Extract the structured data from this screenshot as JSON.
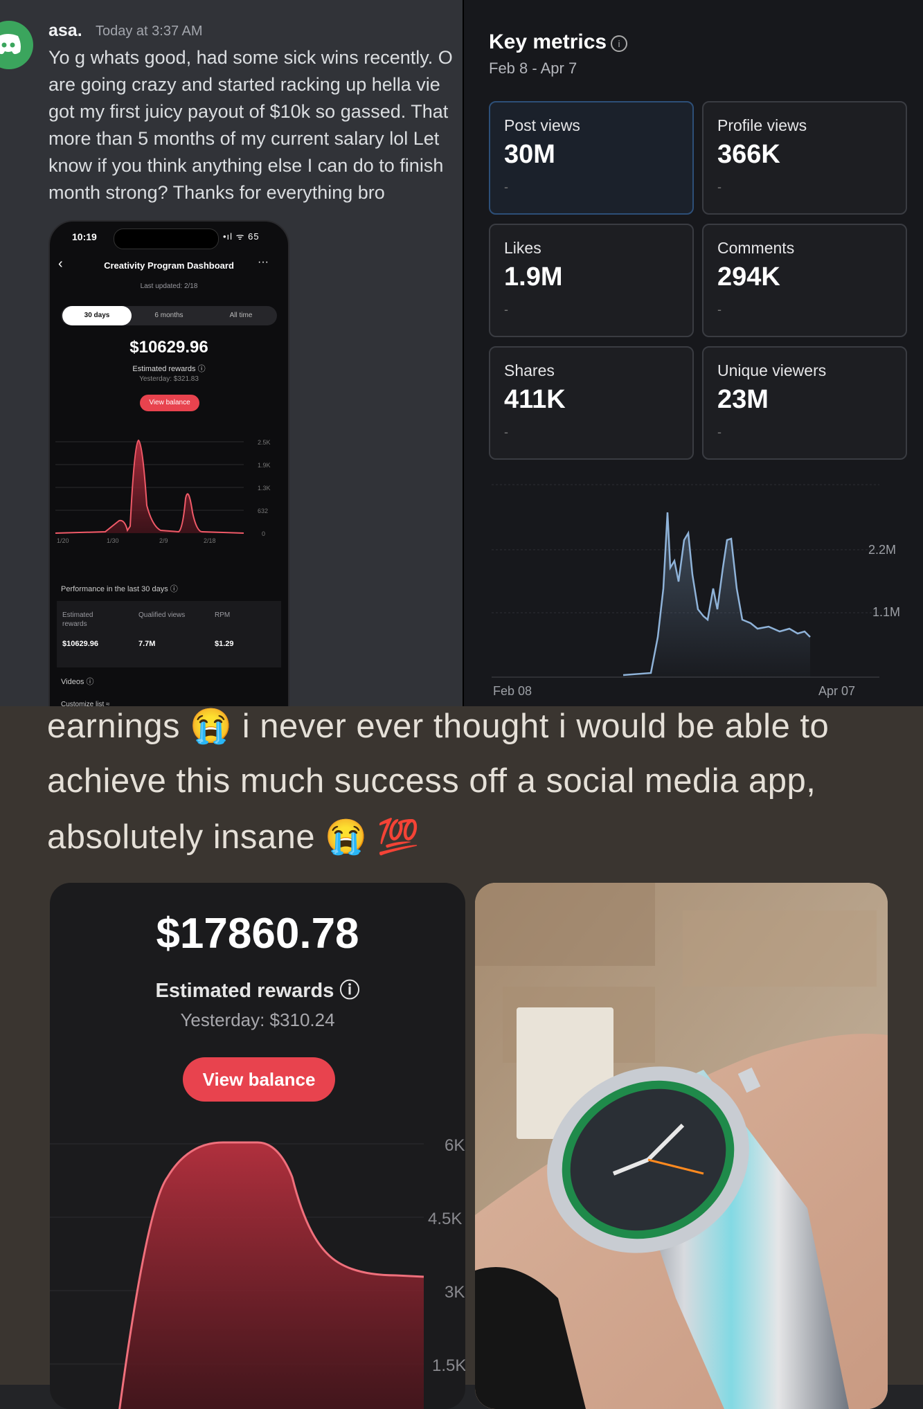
{
  "discord": {
    "username": "asa.",
    "timestamp": "Today at 3:37 AM",
    "message_lines": [
      "Yo g whats good, had some sick wins recently. O",
      "are going crazy and started racking up hella vie",
      "got my first juicy payout of $10k so gassed. That",
      "more than 5 months of my current salary lol Let",
      "know if you think anything else I can do to finish",
      "month strong? Thanks for everything bro"
    ]
  },
  "phone": {
    "time": "10:19",
    "status": "•ıl ᯤ 65",
    "title": "Creativity Program Dashboard",
    "last_updated": "Last updated: 2/18",
    "tabs": [
      "30 days",
      "6 months",
      "All time"
    ],
    "amount": "$10629.96",
    "estimated_rewards": "Estimated rewards ⓘ",
    "yesterday": "Yesterday: $321.83",
    "view_balance": "View balance",
    "chart_y_ticks": [
      "2.5K",
      "1.9K",
      "1.3K",
      "632",
      "0"
    ],
    "chart_x_ticks": [
      "1/20",
      "1/30",
      "2/9",
      "2/18"
    ],
    "performance_label": "Performance in the last 30 days ⓘ",
    "table_headers": [
      "Estimated rewards",
      "Qualified views",
      "RPM"
    ],
    "table_values": [
      "$10629.96",
      "7.7M",
      "$1.29"
    ],
    "videos_label": "Videos ⓘ",
    "customize_label": "Customize list ≈"
  },
  "key_metrics": {
    "title": "Key metrics",
    "date_range": "Feb 8 - Apr 7",
    "cards": [
      {
        "label": "Post views",
        "value": "30M",
        "dash": "-"
      },
      {
        "label": "Profile views",
        "value": "366K",
        "dash": "-"
      },
      {
        "label": "Likes",
        "value": "1.9M",
        "dash": "-"
      },
      {
        "label": "Comments",
        "value": "294K",
        "dash": "-"
      },
      {
        "label": "Shares",
        "value": "411K",
        "dash": "-"
      },
      {
        "label": "Unique viewers",
        "value": "23M",
        "dash": "-"
      }
    ],
    "chart_y_ticks": [
      "2.2M",
      "1.1M"
    ],
    "chart_x_start": "Feb 08",
    "chart_x_end": "Apr 07",
    "line_color": "#8fb3d9"
  },
  "caption": {
    "lines": [
      "earnings 😭 i never ever thought i would be able to",
      "achieve this much success off a social media app,",
      "absolutely insane 😭 💯"
    ]
  },
  "earnings": {
    "amount": "$17860.78",
    "estimated_rewards": "Estimated rewards ⓘ",
    "yesterday": "Yesterday: $310.24",
    "view_balance": "View balance",
    "chart_y_ticks": [
      "6K",
      "4.5K",
      "3K",
      "1.5K"
    ],
    "accent": "#e8434e"
  }
}
